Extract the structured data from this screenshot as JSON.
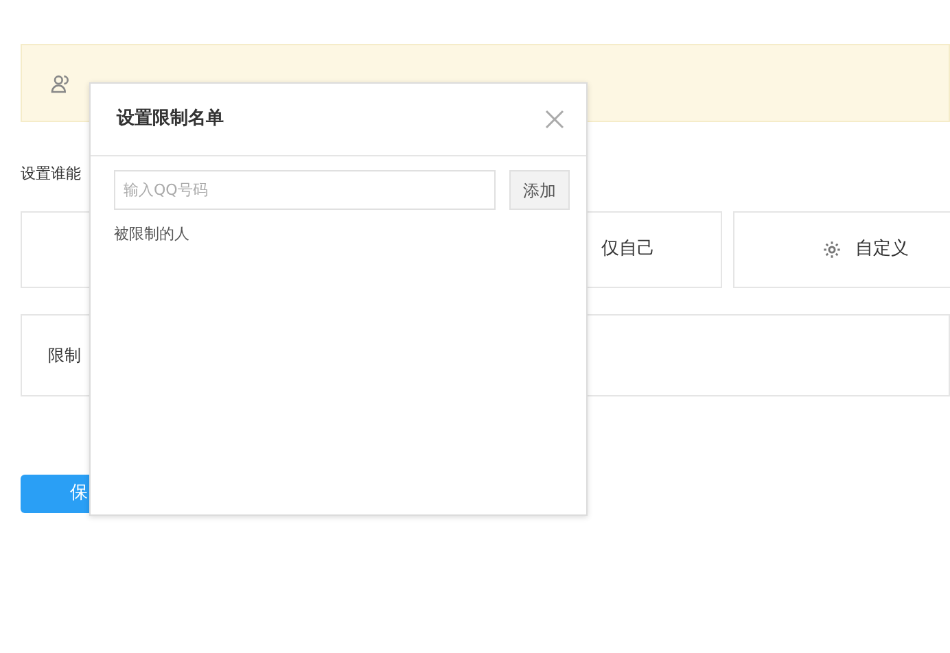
{
  "notice": {
    "kind": "user"
  },
  "section_label": "设置谁能",
  "options": [
    {
      "label": "仅自己"
    },
    {
      "label": "自定义",
      "kind": "gear"
    }
  ],
  "restrict_label": "限制",
  "save_button": "保",
  "dialog": {
    "title": "设置限制名单",
    "input": {
      "placeholder": "输入QQ号码"
    },
    "add_button": "添加",
    "list_label": "被限制的人"
  }
}
